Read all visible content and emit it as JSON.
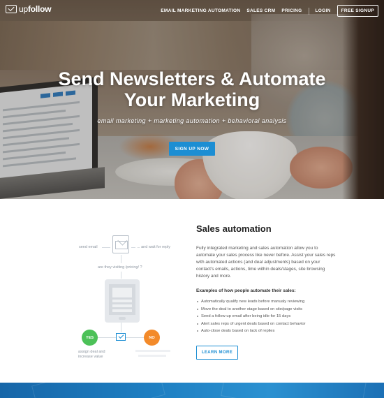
{
  "nav": {
    "logo_bold": "follow",
    "logo_light": "up",
    "links": [
      "EMAIL MARKETING AUTOMATION",
      "SALES CRM",
      "PRICING",
      "LOGIN"
    ],
    "cta": "FREE SIGNUP"
  },
  "hero": {
    "title_line1": "Send Newsletters & Automate",
    "title_line2": "Your Marketing",
    "subtitle": "email marketing + marketing automation + behavioral analysis",
    "signup": "SIGN UP NOW"
  },
  "diagram": {
    "send_email": "send email",
    "wait_reply": "... and wait for reply",
    "visiting": "are they visiting /pricing/ ?",
    "yes": "YES",
    "no": "NO",
    "assign_line1": "assign deal and",
    "assign_line2": "increase value"
  },
  "sales": {
    "title": "Sales automation",
    "description": "Fully integrated marketing and sales automation allow you to automate your sales process like never before. Assist your sales reps with automated actions (and deal adjustments) based on your contact's emails, actions, time within deals/stages, site browsing history and more.",
    "examples_heading": "Examples of how people automate their sales:",
    "examples": [
      "Automatically qualify new leads before manualy reviewing",
      "Move the deal to another stage based on site/page visits",
      "Send a follow up email after being idle for 15 days",
      "Alert sales reps of urgent deals based on contact behavior",
      "Auto-close deals based on lack of replies"
    ],
    "learn_more": "LEARN MORE"
  },
  "colors": {
    "accent": "#1c8ed3",
    "yes": "#4cc158",
    "no": "#f38a2a"
  }
}
